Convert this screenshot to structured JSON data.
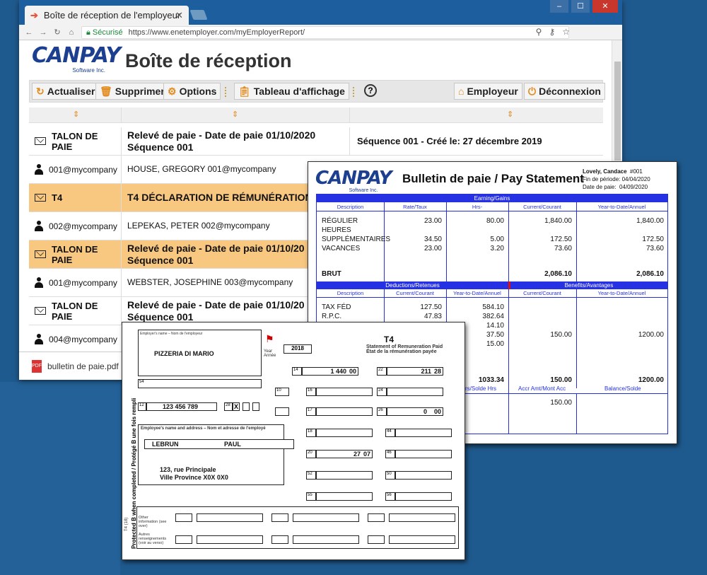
{
  "browser": {
    "tab_title": "Boîte de réception de l'employeur",
    "tab_close": "✕",
    "secure_label": "Sécurisé",
    "url": "https://www.enetemployer.com/myEmployerReport/",
    "window_buttons": [
      "‒",
      "☐",
      "✕"
    ]
  },
  "app": {
    "logo_text": "CANPAY",
    "logo_sub": "Software Inc.",
    "title": "Boîte de réception"
  },
  "toolbar": {
    "refresh": "Actualiser",
    "delete": "Supprimer",
    "options": "Options",
    "dashboard": "Tableau d'affichage",
    "help": "?",
    "employer": "Employeur",
    "logout": "Déconnexion"
  },
  "rows": [
    {
      "c1": "TALON DE PAIE",
      "c2a": "Relevé de paie - Date de paie 01/10/2020",
      "c2b": "Séquence 001",
      "c3": "Séquence 001 - Créé le: 27 décembre 2019"
    },
    {
      "c1": "001@mycompany",
      "c2a": "HOUSE, GREGORY 001@mycompany"
    },
    {
      "c1": "T4",
      "c2a": "T4 DÉCLARATION DE RÉMUNÉRATION"
    },
    {
      "c1": "002@mycompany",
      "c2a": "LEPEKAS, PETER 002@mycompany"
    },
    {
      "c1": "TALON DE PAIE",
      "c2a": "Relevé de paie - Date de paie 01/10/20",
      "c2b": "Séquence 001"
    },
    {
      "c1": "001@mycompany",
      "c2a": "WEBSTER, JOSEPHINE 003@mycompany"
    },
    {
      "c1": "TALON DE PAIE",
      "c2a": "Relevé de paie - Date de paie 01/10/20",
      "c2b": "Séquence 001"
    },
    {
      "c1": "004@mycompany"
    }
  ],
  "download": {
    "file": "bulletin de paie.pdf",
    "chev": "^"
  },
  "pay": {
    "logo_text": "CANPAY",
    "logo_sub": "Software Inc.",
    "title": "Bulletin de paie / Pay Statement",
    "name": "Lovely, Candace",
    "emp_no": "#001",
    "period_label": "Fin de période:",
    "period": "04/04/2020",
    "paydate_label": "Date de paie:",
    "paydate": "04/09/2020",
    "earnings_header": "Earning/Gains",
    "cols": [
      "Description",
      "Rate/Taux",
      "Hrs-",
      "Current/Courant",
      "Year-to-Date/Annuel"
    ],
    "earnings": [
      {
        "d": "RÉGULIER",
        "rate": "23.00",
        "hrs": "80.00",
        "cur": "1,840.00",
        "ytd": "1,840.00"
      },
      {
        "d": "HEURES",
        "rate": "",
        "hrs": "",
        "cur": "",
        "ytd": ""
      },
      {
        "d": "SUPPLÉMENTAIRES",
        "rate": "34.50",
        "hrs": "5.00",
        "cur": "172.50",
        "ytd": "172.50"
      },
      {
        "d": "VACANCES",
        "rate": "23.00",
        "hrs": "3.20",
        "cur": "73.60",
        "ytd": "73.60"
      }
    ],
    "brut_label": "BRUT",
    "brut_cur": "2,086.10",
    "brut_ytd": "2,086.10",
    "ded_header": "Deductions/Retenues",
    "ben_header": "Benefits/Avantages",
    "ded_cols": [
      "Description",
      "Current/Courant",
      "Year-to-Date/Annuel",
      "Current/Courant",
      "Year-to-Date/Annuel"
    ],
    "deductions": [
      {
        "d": "TAX FÉD",
        "cur": "127.50",
        "ytd": "584.10"
      },
      {
        "d": "R.P.C.",
        "cur": "47.83",
        "ytd": "382.64"
      },
      {
        "d": "",
        "cur": "",
        "ytd": "14.10"
      },
      {
        "d": "",
        "cur": "",
        "ytd": "37.50"
      },
      {
        "d": "",
        "cur": "",
        "ytd": "15.00"
      }
    ],
    "ben_cur": "150.00",
    "ben_ytd": "1200.00",
    "bal_val": "1033.34",
    "bal_cur": "150.00",
    "bal_ytd": "1200.00",
    "bal_lbl1": "rs/Solde Hrs",
    "bal_lbl2": "Accr Amt/Mont Acc",
    "bal_lbl3": "Balance/Solde",
    "extra": "150.00"
  },
  "t4": {
    "employer_name": "PIZZERIA DI MARIO",
    "year": "2018",
    "title": "T4",
    "subtitle1": "Statement of Remuneration Paid",
    "subtitle2": "État de la rémunération payée",
    "box14_label": "14",
    "box14": "1 440",
    "box14c": "00",
    "box22_label": "22",
    "box22": "211",
    "box22c": "28",
    "sin": "123 456 789",
    "box12": "12",
    "box16": "16",
    "box24": "24",
    "box17": "17",
    "box26": "26",
    "box26v": "0",
    "box26c": "00",
    "box18": "18",
    "box44": "44",
    "box20": "20",
    "box20v": "27",
    "box20c": "07",
    "box46": "46",
    "box52": "52",
    "box50": "50",
    "box55": "55",
    "box56": "56",
    "box10": "10",
    "box54": "54",
    "box28": "28",
    "x": "X",
    "last_name": "LEBRUN",
    "first_name": "PAUL",
    "address1": "123, rue Principale",
    "address2": "Ville  Province  X0X 0X0",
    "emp_addr_label": "Employee's name and address – Nom et adresse de l'employé",
    "employers_name_label": "Employer's name – Nom de l'employeur",
    "year_label": "Year",
    "year_label_fr": "Année",
    "other_info": "Other information (see over)",
    "autres": "Autres renseignements (voir au verso)",
    "vert_text": "Protected B when completed / Protégé B une fois rempli",
    "t4_form": "T4 (18)"
  }
}
